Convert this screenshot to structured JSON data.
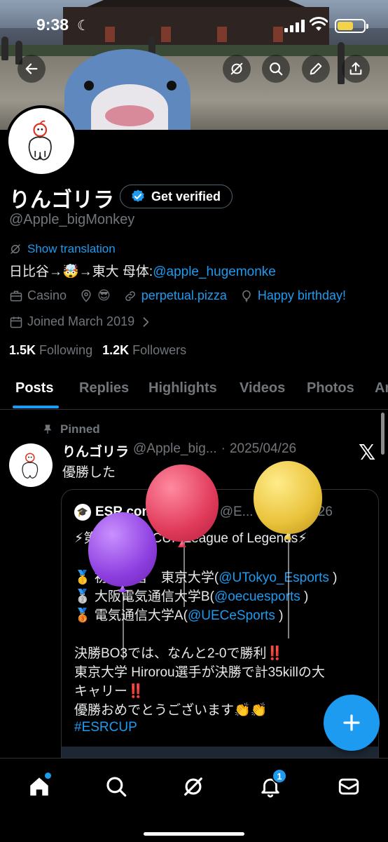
{
  "status_bar": {
    "time": "9:38"
  },
  "profile": {
    "display_name": "りんゴリラ",
    "get_verified_label": "Get verified",
    "handle": "@Apple_bigMonkey",
    "show_translation": "Show translation",
    "bio_text": "日比谷→🤯→東大 母体:",
    "bio_mention": "@apple_hugemonke",
    "category": "Casino",
    "location_emoji": "😎",
    "website": "perpetual.pizza",
    "birthday": "Happy birthday!",
    "joined": "Joined March 2019",
    "following_count": "1.5K",
    "following_label": "Following",
    "followers_count": "1.2K",
    "followers_label": "Followers"
  },
  "tabs": [
    "Posts",
    "Replies",
    "Highlights",
    "Videos",
    "Photos",
    "Ar"
  ],
  "post": {
    "pinned_label": "Pinned",
    "author_name": "りんゴリラ",
    "author_handle": "@Apple_big...",
    "separator": "·",
    "date": "2025/04/26",
    "text": "優勝した",
    "quote": {
      "author_name": "ESR community",
      "author_handle": "@E...",
      "date": "2025/04/26",
      "line1": "⚡第0回 ESR CUP League of Legends⚡",
      "line2_prefix": "🥇 初代王者　東京大学(",
      "line2_mention": "@UTokyo_Esports",
      "line2_suffix": " )",
      "line3_prefix": "🥈 大阪電気通信大学B(",
      "line3_mention": "@oecuesports",
      "line3_suffix": " )",
      "line4_prefix": "🥉 電気通信大学A(",
      "line4_mention": "@UECeSports",
      "line4_suffix": " )",
      "line5": "決勝BO3では、なんと2-0で勝利‼️",
      "line6": "東京大学 Hirorou選手が決勝で計35killの大",
      "line7": "キャリー‼️",
      "line8": "優勝おめでとうございます👏👏",
      "hashtag": "#ESRCUP"
    }
  },
  "bottom_nav": {
    "notification_count": "1"
  },
  "colors": {
    "accent": "#1d9bf0",
    "muted": "#71767b",
    "background": "#000000",
    "divider": "#2f3336"
  }
}
